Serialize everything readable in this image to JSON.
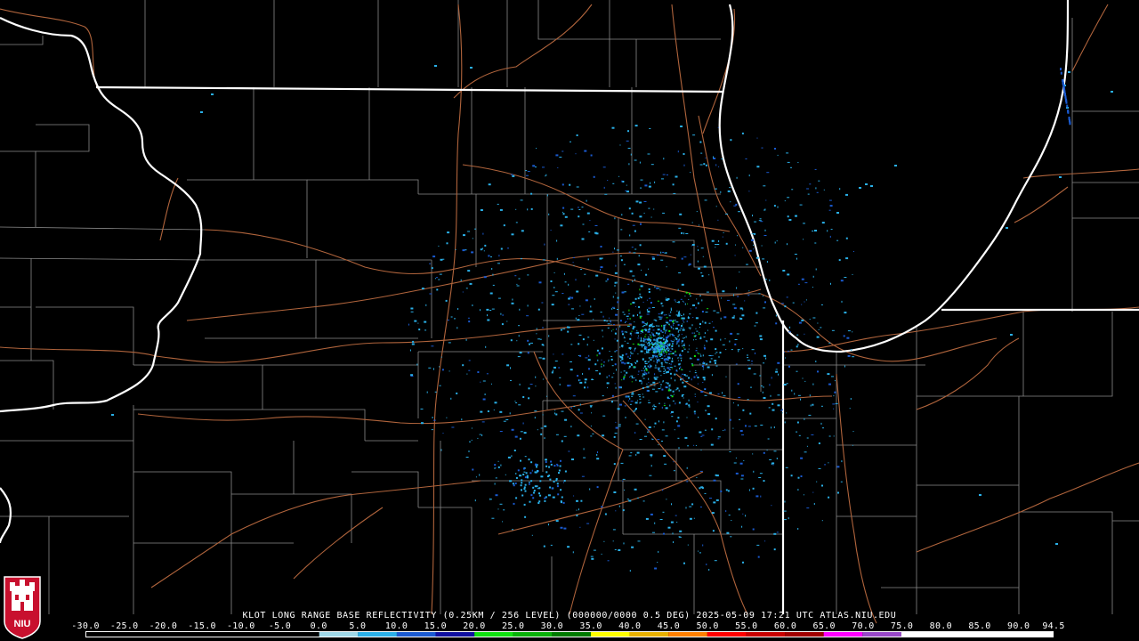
{
  "title": "KLOT LONG RANGE BASE REFLECTIVITY (0.25KM / 256 LEVEL) (000000/0000 0.5 DEG) 2025-05-09 17:21 UTC  ATLAS.NIU.EDU",
  "logo_text": "NIU",
  "legend": {
    "ticks": [
      "-30.0",
      "-25.0",
      "-20.0",
      "-15.0",
      "-10.0",
      "-5.0",
      "0.0",
      "5.0",
      "10.0",
      "15.0",
      "20.0",
      "25.0",
      "30.0",
      "35.0",
      "40.0",
      "45.0",
      "50.0",
      "55.0",
      "60.0",
      "65.0",
      "70.0",
      "75.0",
      "80.0",
      "85.0",
      "90.0",
      "94.5"
    ],
    "segments": [
      {
        "from": -30,
        "to": 0,
        "color": "#000000"
      },
      {
        "from": 0,
        "to": 5,
        "color": "#9fd8e8"
      },
      {
        "from": 5,
        "to": 10,
        "color": "#2ab0e8"
      },
      {
        "from": 10,
        "to": 15,
        "color": "#1a5ad0"
      },
      {
        "from": 15,
        "to": 20,
        "color": "#1010a0"
      },
      {
        "from": 20,
        "to": 25,
        "color": "#10e010"
      },
      {
        "from": 25,
        "to": 30,
        "color": "#08b008"
      },
      {
        "from": 30,
        "to": 35,
        "color": "#007a00"
      },
      {
        "from": 35,
        "to": 40,
        "color": "#ffff00"
      },
      {
        "from": 40,
        "to": 45,
        "color": "#e8b000"
      },
      {
        "from": 45,
        "to": 50,
        "color": "#ff8000"
      },
      {
        "from": 50,
        "to": 55,
        "color": "#ff0000"
      },
      {
        "from": 55,
        "to": 60,
        "color": "#c80000"
      },
      {
        "from": 60,
        "to": 65,
        "color": "#a00000"
      },
      {
        "from": 65,
        "to": 70,
        "color": "#ff00ff"
      },
      {
        "from": 70,
        "to": 75,
        "color": "#9848c8"
      },
      {
        "from": 75,
        "to": 94.5,
        "color": "#ffffff"
      }
    ]
  },
  "colors": {
    "state_borders": "#ffffff",
    "county_lines": "#8a8a8a",
    "highways": "#b0643c",
    "echo_light": "#2ab0e8",
    "echo_dark": "#1a5ad0",
    "echo_green": "#10e010",
    "background": "#000000",
    "lake": "#000000"
  }
}
